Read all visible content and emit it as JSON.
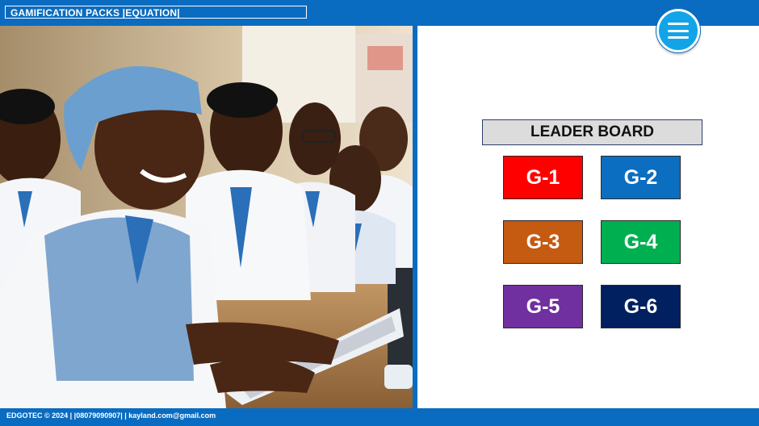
{
  "header": {
    "title": "GAMIFICATION PACKS |EQUATION|"
  },
  "menu": {
    "icon": "hamburger-menu-icon"
  },
  "photo": {
    "description_icon": "students-photo"
  },
  "leaderboard": {
    "title": "LEADER BOARD",
    "groups": [
      {
        "label": "G-1",
        "color": "#ff0000"
      },
      {
        "label": "G-2",
        "color": "#0b6ec0"
      },
      {
        "label": "G-3",
        "color": "#c55a11"
      },
      {
        "label": "G-4",
        "color": "#00b050"
      },
      {
        "label": "G-5",
        "color": "#7030a0"
      },
      {
        "label": "G-6",
        "color": "#002060"
      }
    ]
  },
  "footer": {
    "text": "EDGOTEC © 2024 | |08079090907| | kayland.com@gmail.com"
  },
  "colors": {
    "brand_blue": "#0a6cc0",
    "menu_blue": "#12a4e8"
  }
}
